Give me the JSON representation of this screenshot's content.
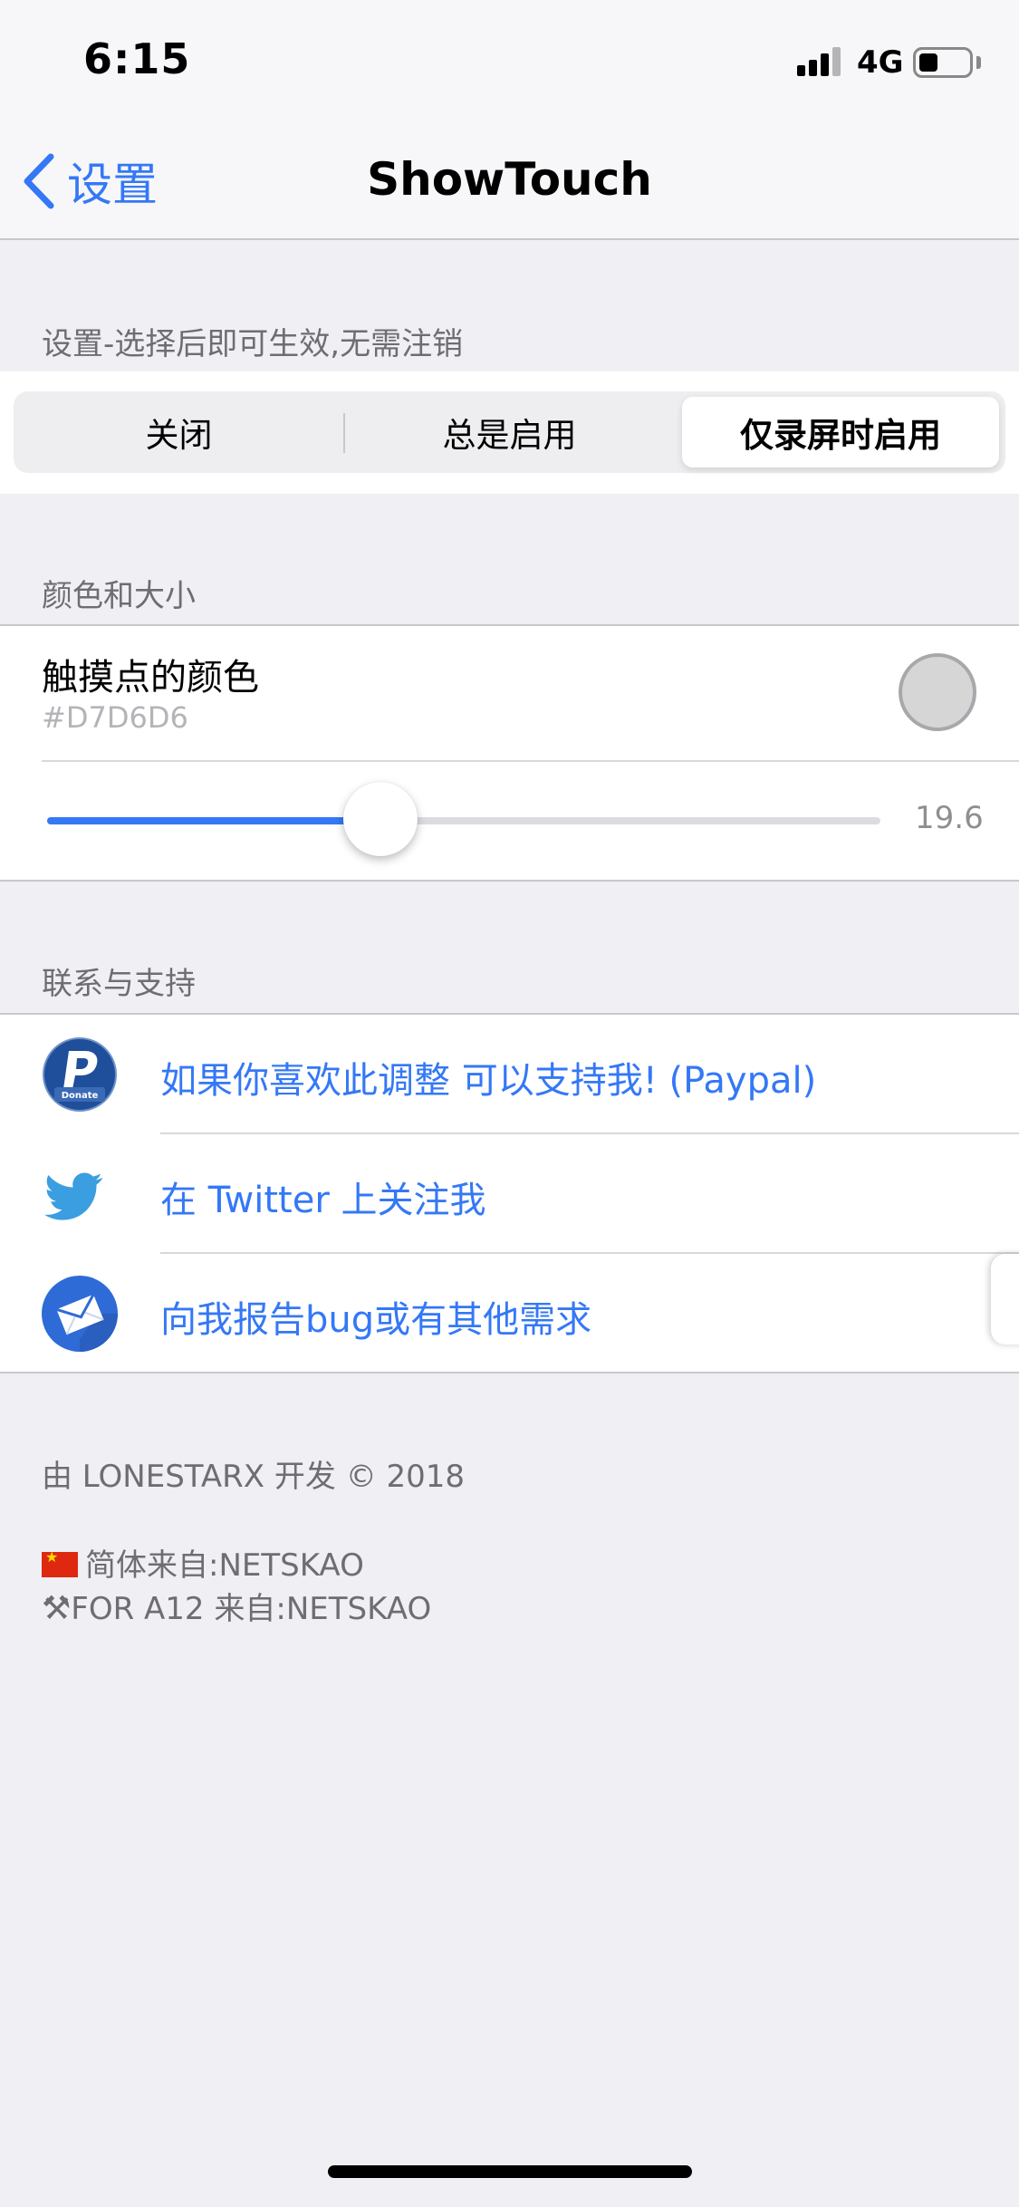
{
  "status_bar": {
    "time": "6:15",
    "network": "4G"
  },
  "nav": {
    "back_label": "设置",
    "title": "ShowTouch"
  },
  "settings": {
    "header": "设置-选择后即可生效,无需注销",
    "segments": [
      "关闭",
      "总是启用",
      "仅录屏时启用"
    ],
    "selected_index": 2
  },
  "appearance": {
    "header": "颜色和大小",
    "color_title": "触摸点的颜色",
    "color_hex": "#D7D6D6",
    "swatch_color": "#d7d6d6",
    "slider_value": "19.6",
    "slider_fraction": 0.4
  },
  "support": {
    "header": "联系与支持",
    "items": [
      {
        "icon": "paypal-donate-icon",
        "label": "如果你喜欢此调整 可以支持我! (Paypal)"
      },
      {
        "icon": "twitter-icon",
        "label": "在 Twitter 上关注我"
      },
      {
        "icon": "mail-icon",
        "label": "向我报告bug或有其他需求"
      }
    ]
  },
  "footer": {
    "credit": "由 LONESTARX 开发 © 2018",
    "translation": "简体来自:NETSKAO",
    "a12": "FOR A12 来自:NETSKAO"
  },
  "colors": {
    "accent": "#3478f6",
    "background": "#efeff4"
  }
}
